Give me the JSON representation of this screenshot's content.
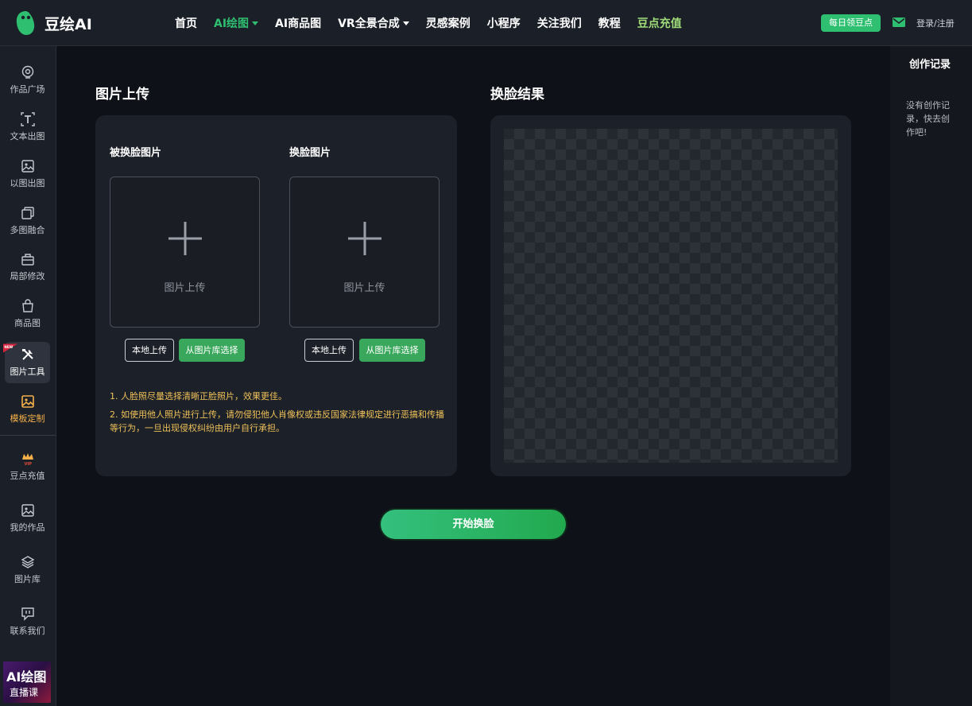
{
  "brand": {
    "name": "豆绘AI",
    "accent": "#2fbf71"
  },
  "nav": {
    "items": [
      {
        "label": "首页"
      },
      {
        "label": "AI绘图"
      },
      {
        "label": "AI商品图"
      },
      {
        "label": "VR全景合成"
      },
      {
        "label": "灵感案例"
      },
      {
        "label": "小程序"
      },
      {
        "label": "关注我们"
      },
      {
        "label": "教程"
      },
      {
        "label": "豆点充值"
      }
    ],
    "daily_button": "每日领豆点",
    "login": "登录/注册"
  },
  "sidebar": {
    "items": [
      {
        "label": "作品广场",
        "icon": "plaza-icon"
      },
      {
        "label": "文本出图",
        "icon": "text-icon"
      },
      {
        "label": "以图出图",
        "icon": "image-icon"
      },
      {
        "label": "多图融合",
        "icon": "layers-copy-icon"
      },
      {
        "label": "局部修改",
        "icon": "edit-region-icon"
      },
      {
        "label": "商品图",
        "icon": "shopping-bag-icon"
      },
      {
        "label": "图片工具",
        "icon": "tools-icon",
        "badge": "NEW"
      },
      {
        "label": "模板定制",
        "icon": "template-icon"
      },
      {
        "label": "豆点充值",
        "icon": "vip-crown-icon"
      },
      {
        "label": "我的作品",
        "icon": "gallery-icon"
      },
      {
        "label": "图片库",
        "icon": "stack-icon"
      },
      {
        "label": "联系我们",
        "icon": "chat-icon"
      }
    ],
    "live_banner": {
      "line1": "AI绘图",
      "line2": "直播课"
    }
  },
  "main": {
    "upload_title": "图片上传",
    "result_title": "换脸结果",
    "source_label": "被换脸图片",
    "target_label": "换脸图片",
    "drop_text": "图片上传",
    "local_upload": "本地上传",
    "from_library": "从图片库选择",
    "notes": [
      "1. 人脸照尽量选择清晰正脸照片，效果更佳。",
      "2. 如使用他人照片进行上传，请勿侵犯他人肖像权或违反国家法律规定进行恶搞和传播等行为，一旦出现侵权纠纷由用户自行承担。"
    ],
    "start_button": "开始换脸"
  },
  "history": {
    "title": "创作记录",
    "empty": "没有创作记录，快去创作吧!"
  }
}
